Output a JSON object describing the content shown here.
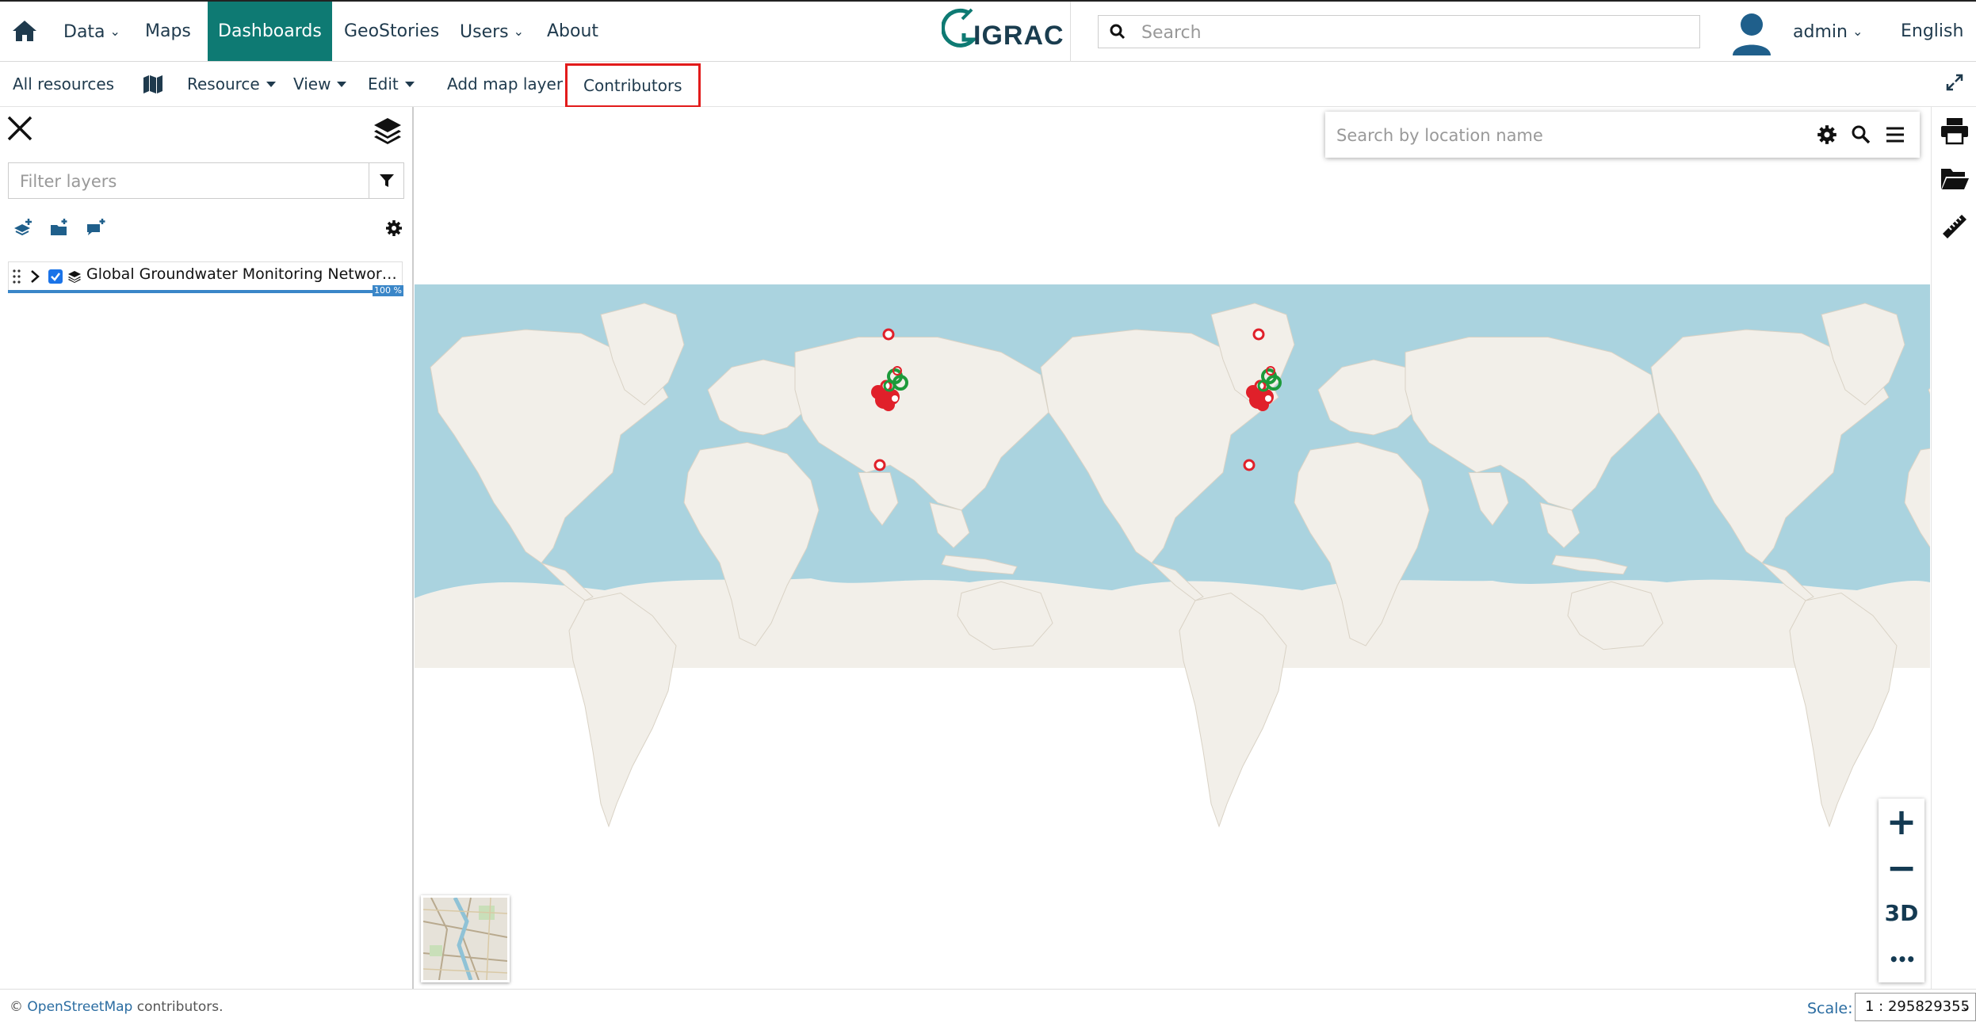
{
  "topnav": {
    "items": [
      {
        "label": "Data",
        "dropdown": true
      },
      {
        "label": "Maps"
      },
      {
        "label": "Dashboards",
        "active": true
      },
      {
        "label": "GeoStories"
      },
      {
        "label": "Users",
        "dropdown": true
      },
      {
        "label": "About"
      }
    ],
    "logo_text": "IGRAC",
    "search_placeholder": "Search",
    "user": "admin",
    "language": "English"
  },
  "toolbar": {
    "all_resources": "All resources",
    "resource": "Resource",
    "view": "View",
    "edit": "Edit",
    "add_map_layer": "Add map layer",
    "contributors": "Contributors"
  },
  "layers_panel": {
    "filter_placeholder": "Filter layers",
    "layers": [
      {
        "name": "Global Groundwater Monitoring Network Time Series",
        "visible": true,
        "progress": "100 %"
      }
    ]
  },
  "map": {
    "location_search_placeholder": "Search by location name",
    "zoom_in": "+",
    "zoom_out": "−",
    "three_d": "3D",
    "more": "•••"
  },
  "footer": {
    "attribution_prefix": "© ",
    "attribution_link": "OpenStreetMap",
    "attribution_suffix": " contributors.",
    "scale_label": "Scale:",
    "scale_value": "1 : 295829355"
  },
  "colors": {
    "accent": "#0e7a73",
    "ocean": "#aad3df",
    "land": "#f2efe9",
    "marker_red": "#e0202a",
    "marker_green": "#1d9a3a",
    "highlight": "#e21b1b"
  }
}
